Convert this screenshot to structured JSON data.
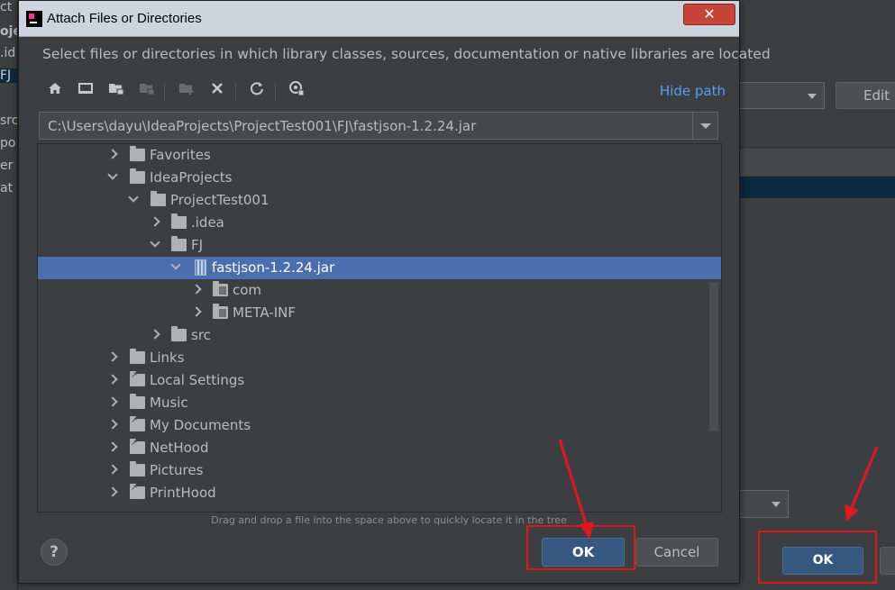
{
  "background": {
    "left_fragments": [
      "ct",
      "oje",
      ".id",
      "FJ",
      "src",
      "po",
      "er",
      "at"
    ],
    "edit_label": "Edit",
    "ok_label": "OK"
  },
  "dialog": {
    "title": "Attach Files or Directories",
    "close_symbol": "✕",
    "description": "Select files or directories in which library classes, sources, documentation or native libraries are located",
    "toolbar": {
      "icons": [
        "home-icon",
        "desktop-icon",
        "project-folder-icon",
        "module-folder-icon",
        "new-folder-icon",
        "delete-icon",
        "refresh-icon",
        "show-hidden-icon"
      ],
      "hide_path_label": "Hide path"
    },
    "path_value": "C:\\Users\\dayu\\IdeaProjects\\ProjectTest001\\FJ\\fastjson-1.2.24.jar",
    "tree": [
      {
        "label": "Favorites",
        "expanded": false,
        "icon": "folder-icon"
      },
      {
        "label": "IdeaProjects",
        "expanded": true,
        "icon": "folder-icon"
      },
      {
        "label": "ProjectTest001",
        "expanded": true,
        "icon": "folder-icon"
      },
      {
        "label": ".idea",
        "expanded": false,
        "icon": "folder-icon"
      },
      {
        "label": "FJ",
        "expanded": true,
        "icon": "folder-icon"
      },
      {
        "label": "fastjson-1.2.24.jar",
        "expanded": true,
        "icon": "jar-icon",
        "selected": true
      },
      {
        "label": "com",
        "expanded": false,
        "icon": "package-icon"
      },
      {
        "label": "META-INF",
        "expanded": false,
        "icon": "package-icon"
      },
      {
        "label": "src",
        "expanded": false,
        "icon": "folder-icon"
      },
      {
        "label": "Links",
        "expanded": false,
        "icon": "folder-icon"
      },
      {
        "label": "Local Settings",
        "expanded": false,
        "icon": "folder-link-icon"
      },
      {
        "label": "Music",
        "expanded": false,
        "icon": "folder-icon"
      },
      {
        "label": "My Documents",
        "expanded": false,
        "icon": "folder-link-icon"
      },
      {
        "label": "NetHood",
        "expanded": false,
        "icon": "folder-link-icon"
      },
      {
        "label": "Pictures",
        "expanded": false,
        "icon": "folder-icon"
      },
      {
        "label": "PrintHood",
        "expanded": false,
        "icon": "folder-link-icon"
      }
    ],
    "hint": "Drag and drop a file into the space above to quickly locate it in the tree",
    "help_label": "?",
    "ok_label": "OK",
    "cancel_label": "Cancel"
  },
  "colors": {
    "annotation": "#e0171d",
    "selection": "#4b6eaf",
    "link": "#589df6",
    "primary_button": "#365880"
  }
}
